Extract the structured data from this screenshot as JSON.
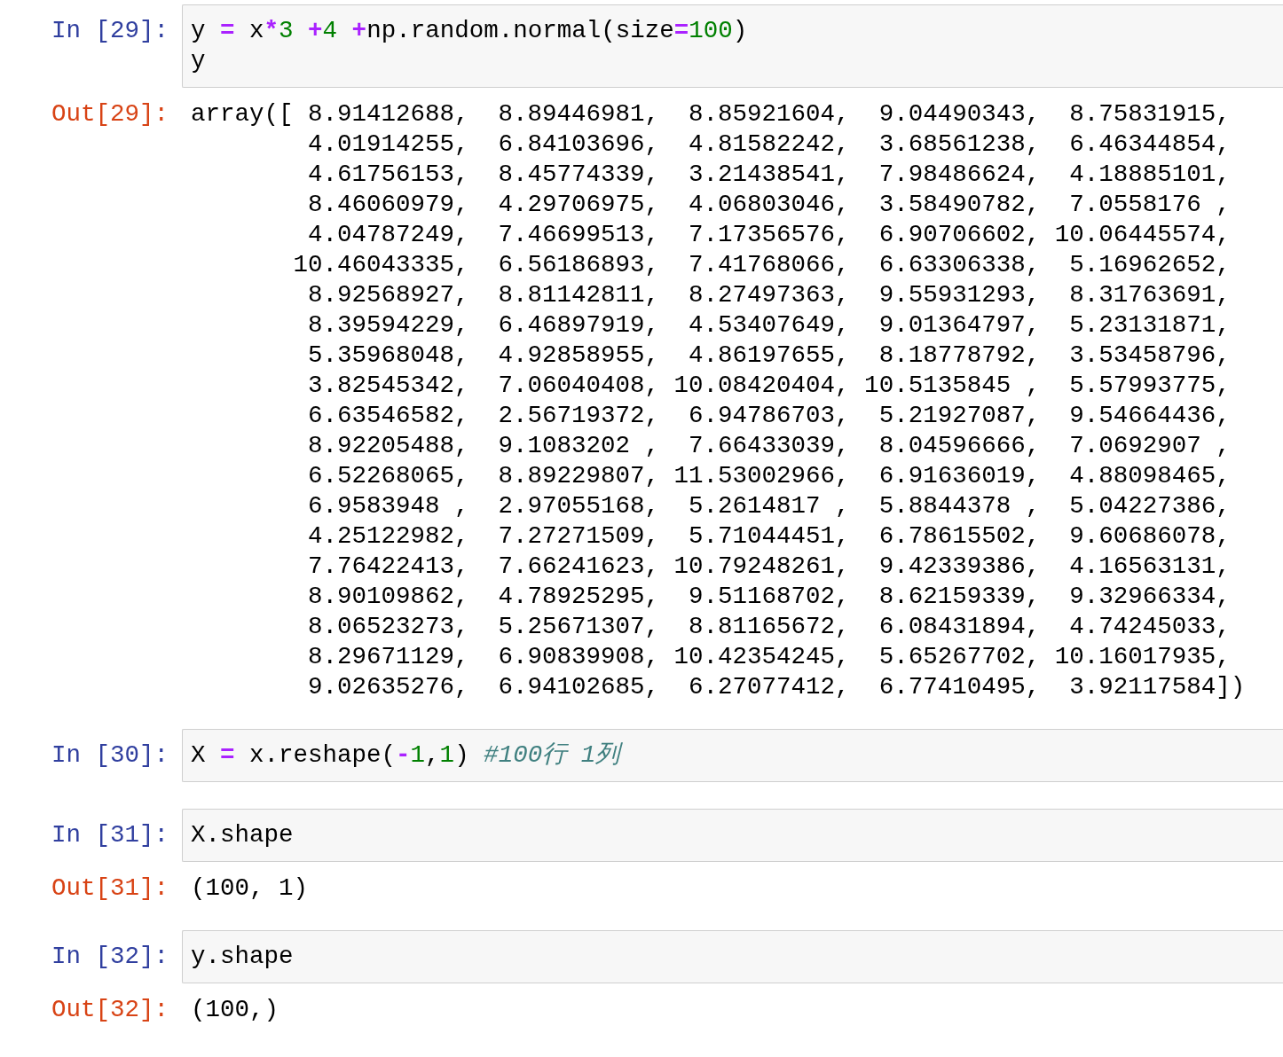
{
  "cells": [
    {
      "kind": "input",
      "prompt": "In [29]:",
      "lines": [
        [
          {
            "t": "y ",
            "kind": "plain"
          },
          {
            "t": "=",
            "kind": "op"
          },
          {
            "t": " x",
            "kind": "plain"
          },
          {
            "t": "*",
            "kind": "op"
          },
          {
            "t": "3",
            "kind": "num"
          },
          {
            "t": " +",
            "kind": "op"
          },
          {
            "t": "4",
            "kind": "num"
          },
          {
            "t": " +",
            "kind": "op"
          },
          {
            "t": "np.random.normal(size",
            "kind": "plain"
          },
          {
            "t": "=",
            "kind": "op"
          },
          {
            "t": "100",
            "kind": "num"
          },
          {
            "t": ")",
            "kind": "plain"
          }
        ],
        [
          {
            "t": "y",
            "kind": "plain"
          }
        ]
      ]
    },
    {
      "kind": "output",
      "prompt": "Out[29]:",
      "lines": [
        "array([ 8.91412688,  8.89446981,  8.85921604,  9.04490343,  8.75831915,",
        "        4.01914255,  6.84103696,  4.81582242,  3.68561238,  6.46344854,",
        "        4.61756153,  8.45774339,  3.21438541,  7.98486624,  4.18885101,",
        "        8.46060979,  4.29706975,  4.06803046,  3.58490782,  7.0558176 ,",
        "        4.04787249,  7.46699513,  7.17356576,  6.90706602, 10.06445574,",
        "       10.46043335,  6.56186893,  7.41768066,  6.63306338,  5.16962652,",
        "        8.92568927,  8.81142811,  8.27497363,  9.55931293,  8.31763691,",
        "        8.39594229,  6.46897919,  4.53407649,  9.01364797,  5.23131871,",
        "        5.35968048,  4.92858955,  4.86197655,  8.18778792,  3.53458796,",
        "        3.82545342,  7.06040408, 10.08420404, 10.5135845 ,  5.57993775,",
        "        6.63546582,  2.56719372,  6.94786703,  5.21927087,  9.54664436,",
        "        8.92205488,  9.1083202 ,  7.66433039,  8.04596666,  7.0692907 ,",
        "        6.52268065,  8.89229807, 11.53002966,  6.91636019,  4.88098465,",
        "        6.9583948 ,  2.97055168,  5.2614817 ,  5.8844378 ,  5.04227386,",
        "        4.25122982,  7.27271509,  5.71044451,  6.78615502,  9.60686078,",
        "        7.76422413,  7.66241623, 10.79248261,  9.42339386,  4.16563131,",
        "        8.90109862,  4.78925295,  9.51168702,  8.62159339,  9.32966334,",
        "        8.06523273,  5.25671307,  8.81165672,  6.08431894,  4.74245033,",
        "        8.29671129,  6.90839908, 10.42354245,  5.65267702, 10.16017935,",
        "        9.02635276,  6.94102685,  6.27077412,  6.77410495,  3.92117584])"
      ]
    },
    {
      "kind": "input",
      "prompt": "In [30]:",
      "lines": [
        [
          {
            "t": "X ",
            "kind": "plain"
          },
          {
            "t": "=",
            "kind": "op"
          },
          {
            "t": " x.reshape(",
            "kind": "plain"
          },
          {
            "t": "-",
            "kind": "op"
          },
          {
            "t": "1",
            "kind": "num"
          },
          {
            "t": ",",
            "kind": "plain"
          },
          {
            "t": "1",
            "kind": "num"
          },
          {
            "t": ") ",
            "kind": "plain"
          },
          {
            "t": "#100行 1列",
            "kind": "comment"
          }
        ]
      ]
    },
    {
      "kind": "input",
      "prompt": "In [31]:",
      "lines": [
        [
          {
            "t": "X.shape",
            "kind": "plain"
          }
        ]
      ]
    },
    {
      "kind": "output",
      "prompt": "Out[31]:",
      "lines": [
        "(100, 1)"
      ]
    },
    {
      "kind": "input",
      "prompt": "In [32]:",
      "lines": [
        [
          {
            "t": "y.shape",
            "kind": "plain"
          }
        ]
      ]
    },
    {
      "kind": "output",
      "prompt": "Out[32]:",
      "lines": [
        "(100,)"
      ]
    }
  ]
}
